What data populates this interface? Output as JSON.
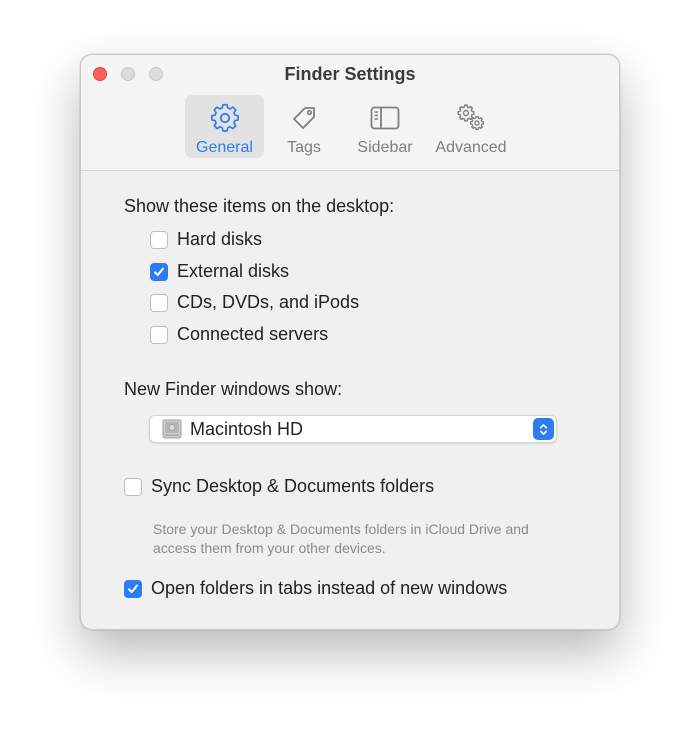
{
  "window": {
    "title": "Finder Settings"
  },
  "tabs": [
    {
      "label": "General",
      "icon": "gear-icon",
      "active": true
    },
    {
      "label": "Tags",
      "icon": "tag-icon",
      "active": false
    },
    {
      "label": "Sidebar",
      "icon": "sidebar-icon",
      "active": false
    },
    {
      "label": "Advanced",
      "icon": "gears-icon",
      "active": false
    }
  ],
  "desktop_section": {
    "label": "Show these items on the desktop:",
    "items": [
      {
        "label": "Hard disks",
        "checked": false
      },
      {
        "label": "External disks",
        "checked": true
      },
      {
        "label": "CDs, DVDs, and iPods",
        "checked": false
      },
      {
        "label": "Connected servers",
        "checked": false
      }
    ]
  },
  "new_window_section": {
    "label": "New Finder windows show:",
    "selected": "Macintosh HD"
  },
  "sync": {
    "label": "Sync Desktop & Documents folders",
    "checked": false,
    "help": "Store your Desktop & Documents folders in iCloud Drive and access them from your other devices."
  },
  "tabs_option": {
    "label": "Open folders in tabs instead of new windows",
    "checked": true
  },
  "colors": {
    "accent": "#2c7df1",
    "close": "#fe5f57"
  }
}
